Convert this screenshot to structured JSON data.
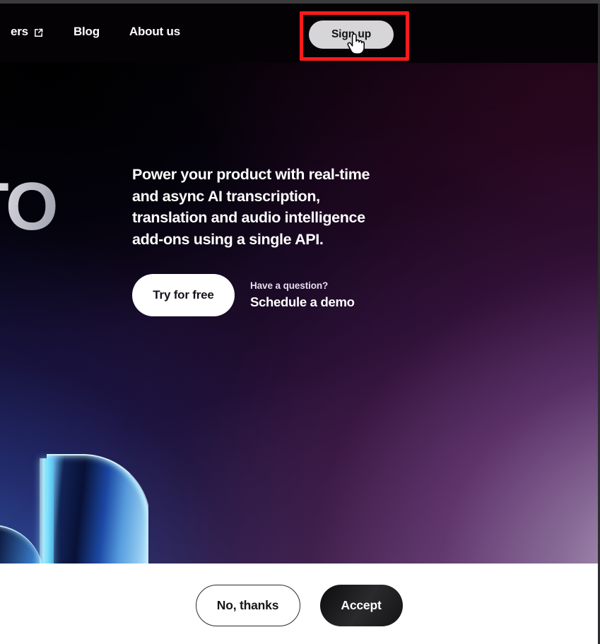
{
  "browser": {
    "chrome_color": "#3c3c3c"
  },
  "navbar": {
    "links": [
      {
        "label": "ers",
        "icon": "external-link-icon",
        "has_icon": true
      },
      {
        "label": "Blog",
        "has_icon": false
      },
      {
        "label": "About us",
        "has_icon": false
      }
    ],
    "signup_label": "Sign up",
    "signup_bg": "#d6d5d7",
    "background": "#050206"
  },
  "annotation": {
    "color": "#ff1a1a",
    "target": "Sign up",
    "cursor": "pointer-hand-cursor"
  },
  "hero": {
    "title_fragment": "TO",
    "subtitle": "Power your product with real-time and async AI transcription, translation and audio intelligence add-ons using a single API.",
    "primary_cta": "Try for free",
    "demo_question": "Have a question?",
    "demo_link": "Schedule a demo",
    "art": "abstract-glass-blade-3d-render",
    "bg_colors": {
      "top_left": "#05030a",
      "top_right": "#3e0a2a",
      "bottom_left": "#2e60b2",
      "bottom_right": "#bab0c4",
      "mid_purple": "#5d3568"
    }
  },
  "cookie_banner": {
    "decline_label": "No, thanks",
    "accept_label": "Accept",
    "background": "#ffffff",
    "accept_bg": "#141416"
  },
  "scrollbar": {
    "edge_color": "#2d2d30"
  }
}
